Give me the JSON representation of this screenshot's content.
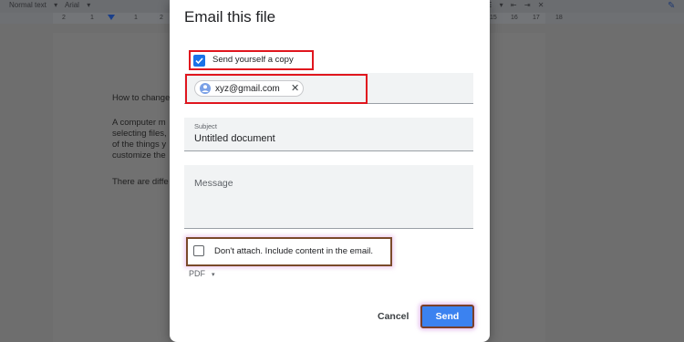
{
  "background": {
    "toolbar": {
      "style_select": "Normal text",
      "font_select": "Arial",
      "chevron": "▾"
    },
    "ruler_numbers": [
      "2",
      "1",
      "1",
      "2",
      "15",
      "16",
      "17",
      "18"
    ],
    "doc_lines": [
      "How to change",
      "A computer m",
      "selecting files,",
      "of the things y",
      "customize the",
      "There are diffe"
    ]
  },
  "dialog": {
    "title": "Email this file",
    "send_copy": {
      "label": "Send yourself a copy",
      "checked": true
    },
    "recipient": {
      "email": "xyz@gmail.com",
      "remove_icon": "close-icon"
    },
    "subject": {
      "label": "Subject",
      "value": "Untitled document"
    },
    "message": {
      "placeholder": "Message"
    },
    "attach": {
      "label": "Don't attach. Include content in the email.",
      "checked": false
    },
    "format": {
      "value": "PDF",
      "caret": "▾"
    },
    "buttons": {
      "cancel": "Cancel",
      "send": "Send"
    }
  },
  "colors": {
    "accent": "#1a73e8",
    "send_button": "#3b82f0",
    "highlight_red": "#e0161e"
  }
}
